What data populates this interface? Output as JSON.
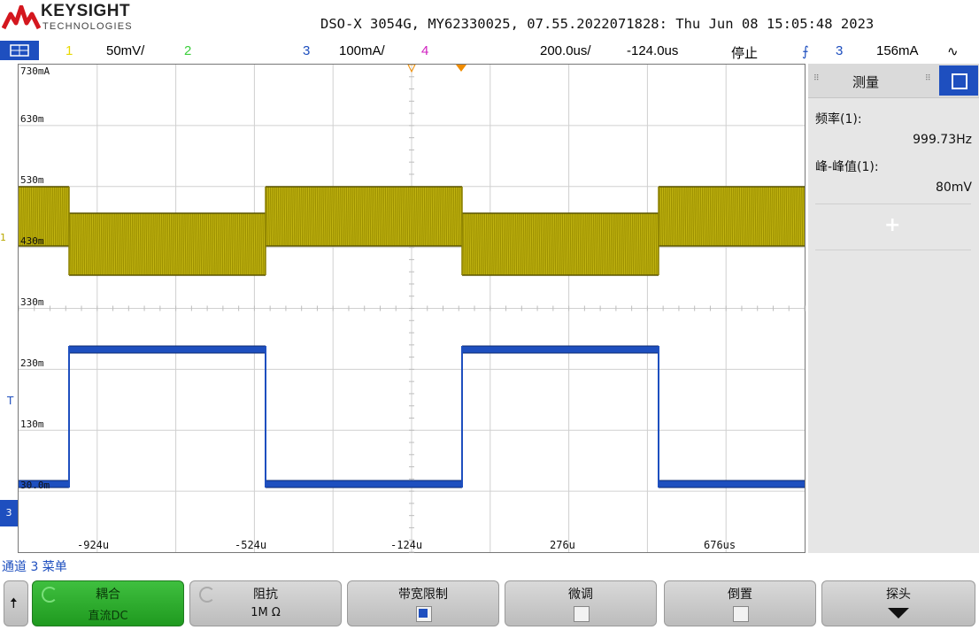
{
  "header": {
    "brand": "KEYSIGHT",
    "brand_sub": "TECHNOLOGIES",
    "title": "DSO-X 3054G, MY62330025, 07.55.2022071828: Thu Jun 08 15:05:48 2023"
  },
  "channel_bar": {
    "ch1_num": "1",
    "ch1_scale": "50mV/",
    "ch2_num": "2",
    "ch3_num": "3",
    "ch3_scale": "100mA/",
    "ch4_num": "4",
    "timebase": "200.0us/",
    "delay": "-124.0us",
    "run_state": "停止",
    "trigger_source": "3",
    "trigger_level": "156mA"
  },
  "screen": {
    "y_labels": [
      "730mA",
      "630m",
      "530m",
      "430m",
      "330m",
      "230m",
      "130m",
      "30.0m"
    ],
    "x_labels": [
      "-924u",
      "-524u",
      "-124u",
      "276u",
      "676us"
    ],
    "left_markers": {
      "ch1": "1",
      "trigger": "T",
      "ch3": "3"
    }
  },
  "measure_panel": {
    "title": "测量",
    "freq_label": "频率(1):",
    "freq_value": "999.73Hz",
    "pp_label": "峰-峰值(1):",
    "pp_value": "80mV",
    "add": "+"
  },
  "menu": {
    "title": "通道 3 菜单",
    "coupling_label": "耦合",
    "coupling_value": "直流DC",
    "impedance_label": "阻抗",
    "impedance_value": "1M Ω",
    "bw_limit_label": "带宽限制",
    "bw_limit_checked": true,
    "fine_label": "微调",
    "fine_checked": false,
    "invert_label": "倒置",
    "invert_checked": false,
    "probe_label": "探头"
  },
  "colors": {
    "ch1": "#b5a700",
    "ch2": "#3ccf3c",
    "ch3": "#1e4fbf",
    "ch4": "#d020c0",
    "accent": "#1e4fbf"
  }
}
